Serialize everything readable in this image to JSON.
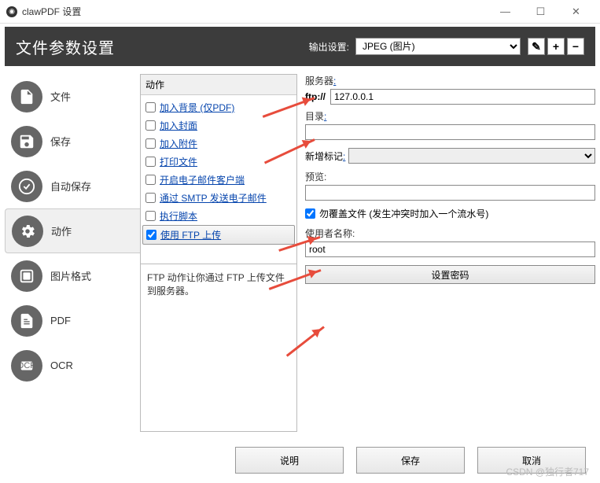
{
  "titlebar": {
    "title": "clawPDF 设置"
  },
  "header": {
    "title": "文件参数设置",
    "output_label": "输出设置:",
    "output_value": "JPEG (图片)",
    "edit_icon": "✎",
    "plus": "+",
    "minus": "−"
  },
  "sidebar": {
    "items": [
      {
        "label": "文件"
      },
      {
        "label": "保存"
      },
      {
        "label": "自动保存"
      },
      {
        "label": "动作"
      },
      {
        "label": "图片格式"
      },
      {
        "label": "PDF"
      },
      {
        "label": "OCR"
      }
    ]
  },
  "actions": {
    "header": "动作",
    "items": [
      {
        "label": "加入背景 (仅PDF)",
        "checked": false
      },
      {
        "label": "加入封面",
        "checked": false
      },
      {
        "label": "加入附件",
        "checked": false
      },
      {
        "label": "打印文件",
        "checked": false
      },
      {
        "label": "开启电子邮件客户端",
        "checked": false
      },
      {
        "label": "通过 SMTP 发送电子邮件",
        "checked": false
      },
      {
        "label": "执行脚本",
        "checked": false
      },
      {
        "label": "使用 FTP 上传",
        "checked": true
      }
    ],
    "description": "FTP 动作让你通过 FTP 上传文件到服务器。"
  },
  "ftp": {
    "server_label": "服务器",
    "server_prefix": "ftp://",
    "server_value": "127.0.0.1",
    "dir_label": "目录",
    "dir_value": "",
    "new_tag_label": "新增标记",
    "preview_label": "预览:",
    "preview_value": "",
    "overwrite_label": "勿覆盖文件 (发生冲突时加入一个流水号)",
    "overwrite_checked": true,
    "user_label": "使用者名称:",
    "user_value": "root",
    "set_password": "设置密码"
  },
  "footer": {
    "help": "说明",
    "save": "保存",
    "cancel": "取消"
  },
  "watermark": "CSDN @独行者717"
}
